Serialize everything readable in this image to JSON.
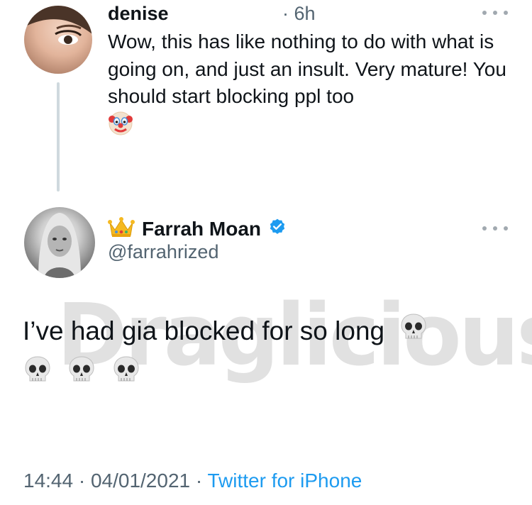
{
  "reply": {
    "name": "denise",
    "time": "· 6h",
    "text": "Wow, this has like nothing to do with what is going on, and just an insult. Very mature! You should start blocking ppl too",
    "emoji_icon": "clown-face-icon"
  },
  "tweet": {
    "name": "Farrah Moan",
    "handle": "@farrahrized",
    "text": "I’ve had gia blocked for so long",
    "name_icon": "crown-icon",
    "verified_icon": "verified-badge-icon",
    "emoji_icon": "skull-icon",
    "trailing_skull_count": 3
  },
  "watermark": "Draglicious",
  "footer": {
    "datetime": "14:44 · 04/01/2021 · ",
    "source": "Twitter for iPhone"
  },
  "colors": {
    "text": "#0f1419",
    "secondary": "#536471",
    "link": "#1d9bf0",
    "thread_line": "#cfd9de"
  }
}
